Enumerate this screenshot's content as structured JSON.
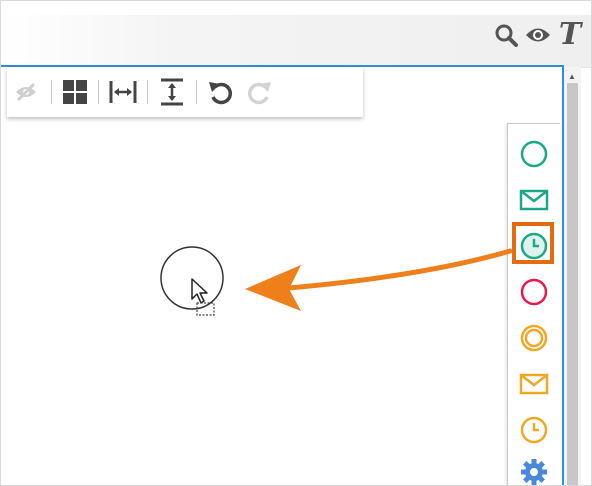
{
  "header": {
    "tools": [
      {
        "name": "search",
        "icon": "search-icon"
      },
      {
        "name": "view",
        "icon": "eye-icon"
      },
      {
        "name": "text",
        "icon": "text-tool-icon",
        "glyph": "T"
      }
    ]
  },
  "toolbar": {
    "items": [
      {
        "icon": "hide-icon"
      },
      {
        "icon": "grid-layout-icon"
      },
      {
        "icon": "distribute-horizontal-icon"
      },
      {
        "icon": "distribute-vertical-icon"
      },
      {
        "icon": "undo-icon"
      },
      {
        "icon": "redo-icon",
        "disabled": true
      }
    ]
  },
  "palette": {
    "items": [
      {
        "icon": "start-event-icon",
        "color": "#1aa889"
      },
      {
        "icon": "message-start-event-icon",
        "color": "#1aa889"
      },
      {
        "icon": "timer-start-event-icon",
        "color": "#1aa889",
        "highlighted": true
      },
      {
        "icon": "end-event-icon",
        "color": "#e8194f"
      },
      {
        "icon": "intermediate-event-icon",
        "color": "#f0a824"
      },
      {
        "icon": "message-intermediate-event-icon",
        "color": "#f0a824"
      },
      {
        "icon": "timer-intermediate-event-icon",
        "color": "#f0a824"
      },
      {
        "icon": "gear-icon",
        "color": "#4a89d8"
      }
    ]
  },
  "canvas": {
    "dropped_shape": "event-circle",
    "drag_arrow_color": "#ef7f1a",
    "highlight_color": "#e46b10",
    "panel_border_color": "#2f8fd8"
  }
}
